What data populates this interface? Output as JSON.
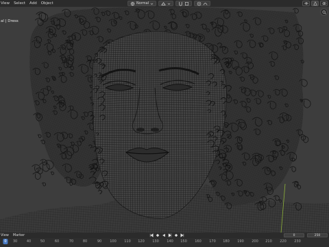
{
  "header": {
    "menus": [
      "View",
      "Select",
      "Add",
      "Object"
    ],
    "shading_mode": "Normal",
    "icons": [
      "orientation-icon",
      "pivot-icon",
      "snap-icon",
      "proportional-icon"
    ]
  },
  "viewport": {
    "object_label": "al | Dress"
  },
  "timeline": {
    "menus": [
      "View",
      "Marker"
    ],
    "current_frame": "0",
    "end_frame": "250",
    "ticks": [
      "0",
      "30",
      "40",
      "50",
      "60",
      "70",
      "80",
      "90",
      "100",
      "110",
      "120",
      "130",
      "140",
      "150",
      "160",
      "170",
      "180",
      "190",
      "200",
      "210",
      "220",
      "230"
    ],
    "cursor_value": "0"
  },
  "colors": {
    "wire": "#141414",
    "accent_blue": "#4a7bc4",
    "axis_green": "#8fb33a"
  }
}
